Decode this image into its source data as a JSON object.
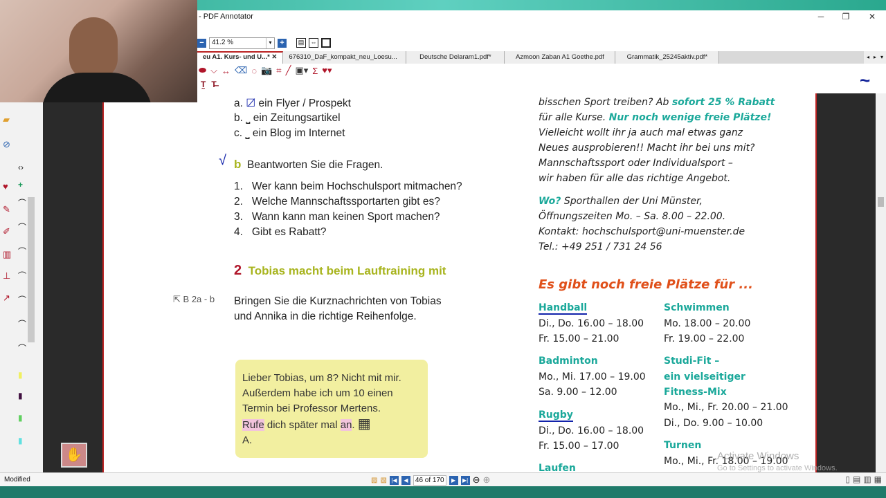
{
  "window": {
    "title": "- PDF Annotator",
    "minimize": "─",
    "maximize": "❐",
    "close": "✕"
  },
  "toolbar": {
    "zoom_value": "41.2 %",
    "zoom_out": "−",
    "zoom_in": "+"
  },
  "tabs": [
    {
      "label": "eu A1. Kurs- und U...*",
      "active": true,
      "close": "✕"
    },
    {
      "label": "676310_DaF_kompakt_neu_Loesu..."
    },
    {
      "label": "Deutsche Delaram1.pdf*"
    },
    {
      "label": "Azmoon Zaban A1 Goethe.pdf"
    },
    {
      "label": "Grammatik_25245aktiv.pdf*"
    }
  ],
  "tab_nav": {
    "prev": "◂",
    "next": "▸",
    "menu": "▾"
  },
  "page": {
    "options": [
      {
        "letter": "a.",
        "text": "ein Flyer / Prospekt",
        "checked": true
      },
      {
        "letter": "b.",
        "text": "ein Zeitungsartikel"
      },
      {
        "letter": "c.",
        "text": "ein Blog im Internet"
      }
    ],
    "section_b": {
      "letter": "b",
      "title": "Beantworten Sie die Fragen."
    },
    "questions": [
      {
        "n": "1.",
        "q": "Wer kann beim Hochschulsport mitmachen?"
      },
      {
        "n": "2.",
        "q": "Welche Mannschaftssportarten gibt es?"
      },
      {
        "n": "3.",
        "q": "Wann kann man keinen Sport machen?"
      },
      {
        "n": "4.",
        "q": "Gibt es Rabatt?"
      }
    ],
    "exercise2": {
      "number": "2",
      "title": "Tobias macht beim Lauftraining mit",
      "ref": "B 2a - b",
      "instruction1": "Bringen Sie die Kurznachrichten von Tobias",
      "instruction2": "und Annika in die richtige Reihenfolge."
    },
    "message": {
      "l1": "Lieber Tobias, um 8? Nicht mit mir.",
      "l2": "Außerdem habe ich um 10 einen",
      "l3": "Termin bei Professor Mertens.",
      "l4a": "Rufe",
      "l4b": " dich später mal ",
      "l4c": "an",
      "l4d": ".",
      "l5": "A."
    },
    "flyer": {
      "l1a": "bisschen Sport treiben? Ab ",
      "l1b": "sofort 25 % Rabatt",
      "l2a": "für alle Kurse. ",
      "l2b": "Nur noch wenige freie Plätze!",
      "l3": "Vielleicht wollt ihr ja auch mal etwas ganz",
      "l4": "Neues ausprobieren!! Macht ihr bei uns mit?",
      "l5": "Mannschaftssport oder Individualsport –",
      "l6": "wir haben für alle das richtige Angebot.",
      "wo": "Wo?",
      "l7": " Sporthallen der Uni Münster,",
      "l8": "Öffnungszeiten Mo. – Sa. 8.00 – 22.00.",
      "l9": "Kontakt: hochschulsport@uni-muenster.de",
      "l10": "Tel.: +49 251 / 731 24 56",
      "heading": "Es gibt noch freie Plätze für ...",
      "sports": [
        {
          "name": "Handball",
          "times": [
            "Di., Do. 16.00 – 18.00",
            "Fr. 15.00 – 21.00"
          ]
        },
        {
          "name": "Badminton",
          "times": [
            "Mo., Mi. 17.00 – 19.00",
            "Sa. 9.00 – 12.00"
          ]
        },
        {
          "name": "Rugby",
          "times": [
            "Di., Do. 16.00 – 18.00",
            "Fr. 15.00 – 17.00"
          ]
        },
        {
          "name": "Laufen"
        },
        {
          "name": "Schwimmen",
          "times": [
            "Mo. 18.00 – 20.00",
            "Fr. 19.00 – 22.00"
          ]
        },
        {
          "name": "Studi-Fit –",
          "name2": "ein vielseitiger",
          "name3": "Fitness-Mix",
          "times": [
            "Mo., Mi., Fr. 20.00 – 21.00",
            "Di., Do. 9.00 – 10.00"
          ]
        },
        {
          "name": "Turnen",
          "times": [
            "Mo., Mi., Fr. 18.00 – 19.00"
          ]
        }
      ]
    }
  },
  "watermark": {
    "l1": "Activate Windows",
    "l2": "Go to Settings to activate Windows."
  },
  "status": {
    "text": "Modified",
    "page_indicator": "46 of 170"
  },
  "colors": {
    "accent": "#b0162a",
    "teal": "#1aa89a",
    "orange": "#e0501a",
    "olive": "#a8b41e",
    "pen": "#112299"
  }
}
